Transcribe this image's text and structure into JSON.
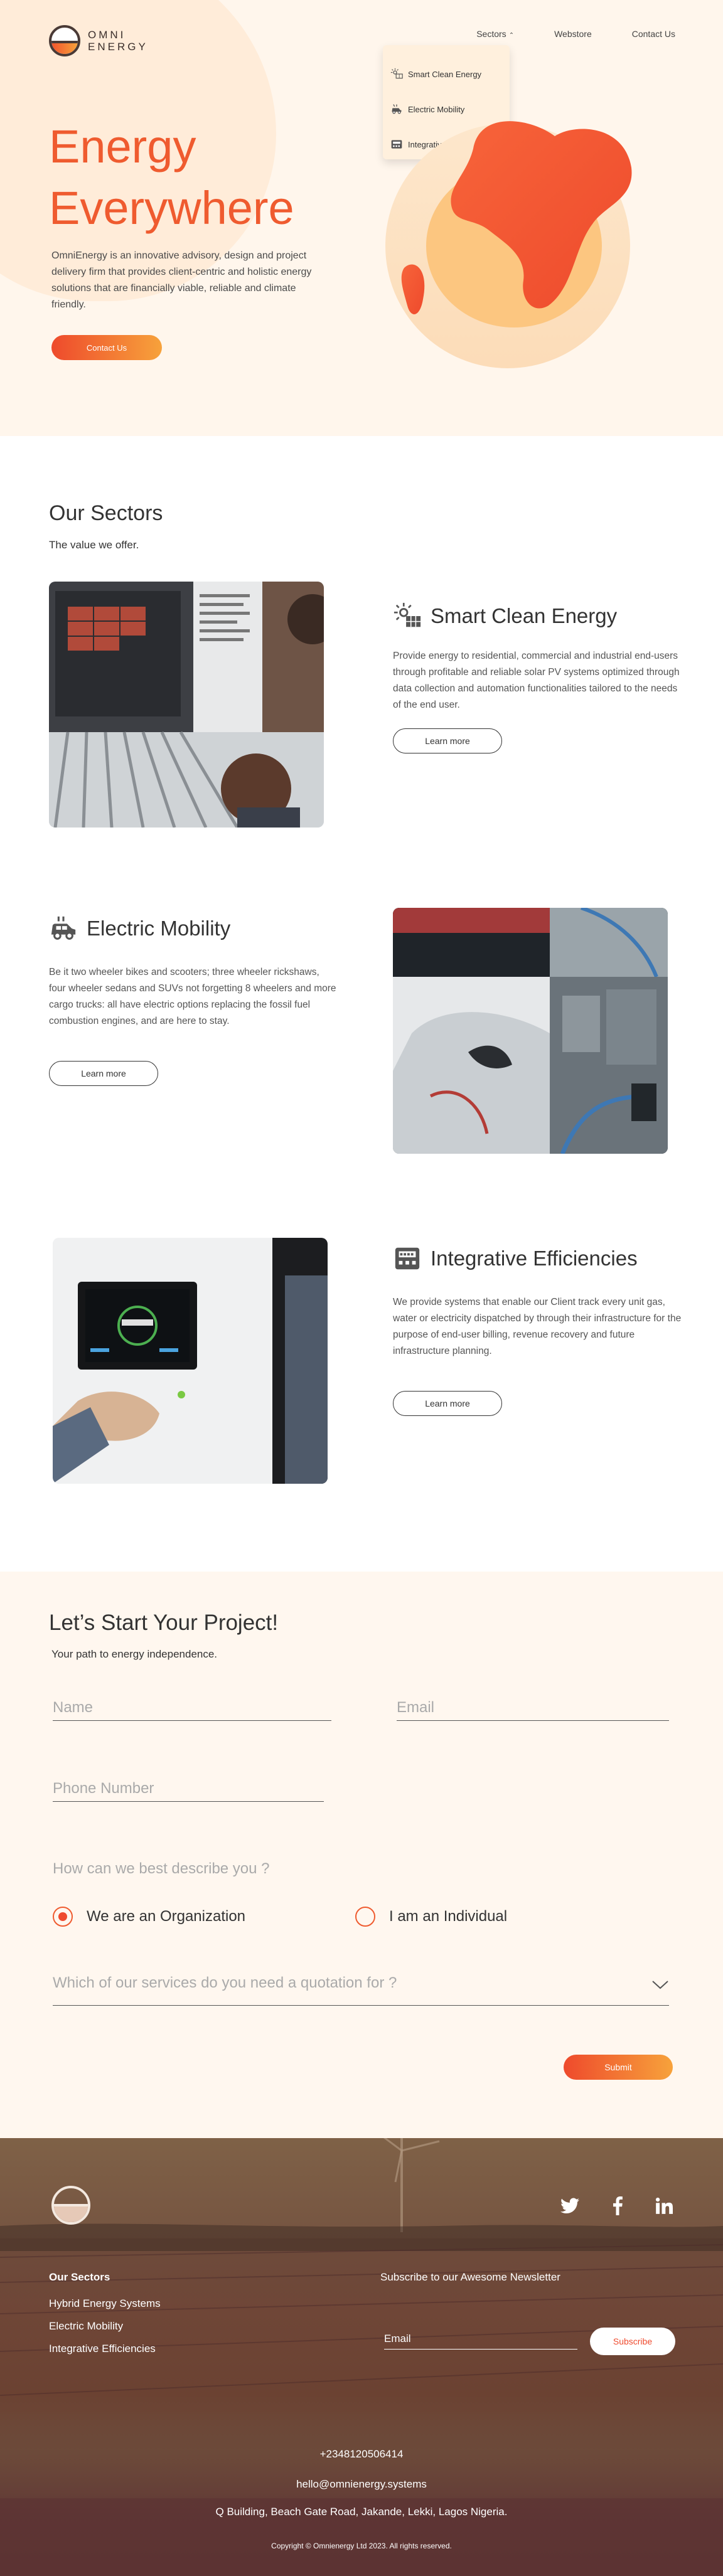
{
  "brand": {
    "line1": "OMNI",
    "line2": "ENERGY"
  },
  "nav": {
    "sectors": "Sectors",
    "webstore": "Webstore",
    "contact": "Contact Us"
  },
  "dropdown": [
    {
      "label": "Smart Clean Energy",
      "icon": "solar-panel-icon"
    },
    {
      "label": "Electric Mobility",
      "icon": "electric-car-icon"
    },
    {
      "label": "Integrative Efficiencies",
      "icon": "meter-icon"
    }
  ],
  "hero": {
    "title_line1": "Energy",
    "title_line2": "Everywhere",
    "description": "OmniEnergy is an innovative advisory, design and project delivery firm that provides client-centric and holistic energy solutions that are financially viable, reliable and climate friendly.",
    "cta": "Contact Us"
  },
  "sectors": {
    "title": "Our Sectors",
    "subtitle": "The value we offer.",
    "items": [
      {
        "title": "Smart Clean Energy",
        "icon": "solar-panel-icon",
        "description": "Provide energy to residential, commercial and industrial end-users through profitable and reliable solar PV systems optimized through data collection and automation functionalities tailored to the needs of the end user.",
        "button": "Learn more"
      },
      {
        "title": "Electric Mobility",
        "icon": "electric-car-icon",
        "description": "Be it two wheeler bikes and scooters; three wheeler rickshaws, four wheeler sedans and SUVs not forgetting 8 wheelers and more cargo trucks: all have electric options replacing the fossil fuel combustion engines, and are here to stay.",
        "button": "Learn more"
      },
      {
        "title": "Integrative Efficiencies",
        "icon": "meter-icon",
        "description": "We provide systems that enable our Client track every unit gas, water or electricity dispatched by through their infrastructure for the purpose of end-user billing, revenue recovery and future infrastructure planning.",
        "button": "Learn more"
      }
    ]
  },
  "contact": {
    "title": "Let’s Start Your Project!",
    "subtitle": "Your path to energy independence.",
    "name_placeholder": "Name",
    "email_placeholder": "Email",
    "phone_placeholder": "Phone Number",
    "question": "How can we best describe you ?",
    "option_org": "We are an Organization",
    "option_individual": "I am an Individual",
    "services_placeholder": "Which of our services do you need a quotation for ?",
    "submit": "Submit"
  },
  "footer": {
    "sectors_heading": "Our Sectors",
    "links": [
      "Hybrid Energy Systems",
      "Electric Mobility",
      "Integrative Efficiencies"
    ],
    "newsletter": "Subscribe to our Awesome Newsletter",
    "email_placeholder": "Email",
    "subscribe": "Subscribe",
    "phone": "+2348120506414",
    "email": "hello@omnienergy.systems",
    "address": "Q Building, Beach Gate Road, Jakande, Lekki, Lagos Nigeria.",
    "copyright": "Copyright © Omnienergy Ltd 2023. All rights reserved.",
    "social": [
      "twitter-icon",
      "facebook-icon",
      "linkedin-icon"
    ]
  },
  "colors": {
    "accent": "#ef5b2f",
    "accent_end": "#f7a23b",
    "hero_bg": "#fff6ec",
    "footer_bg": "#6b4232"
  }
}
